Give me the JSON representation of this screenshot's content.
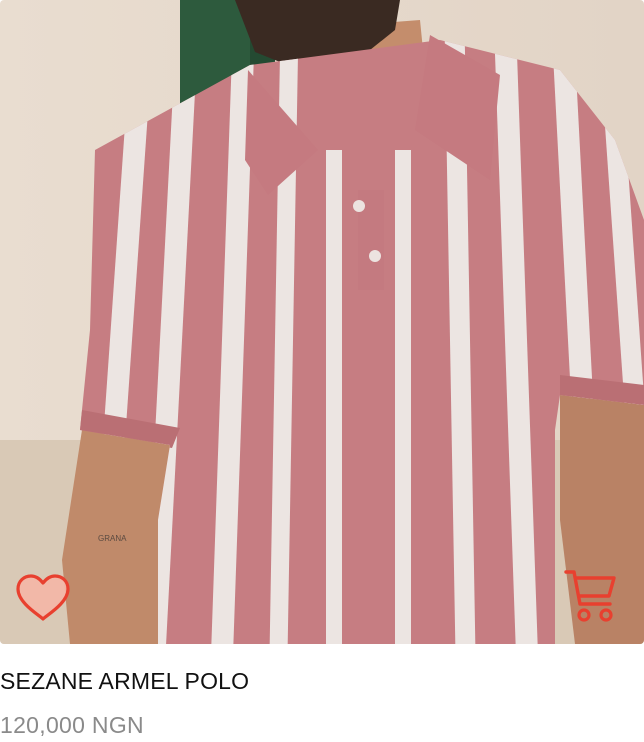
{
  "product": {
    "name": "SEZANE ARMEL POLO",
    "price": "120,000 NGN"
  },
  "icons": {
    "favorite": "heart-icon",
    "cart": "cart-icon"
  },
  "colors": {
    "accent": "#e8402f",
    "heart_fill": "#f4b6a6",
    "title": "#111111",
    "price": "#8a8a8a",
    "shirt_pink": "#cf8388",
    "shirt_stripe": "#f6efec"
  }
}
